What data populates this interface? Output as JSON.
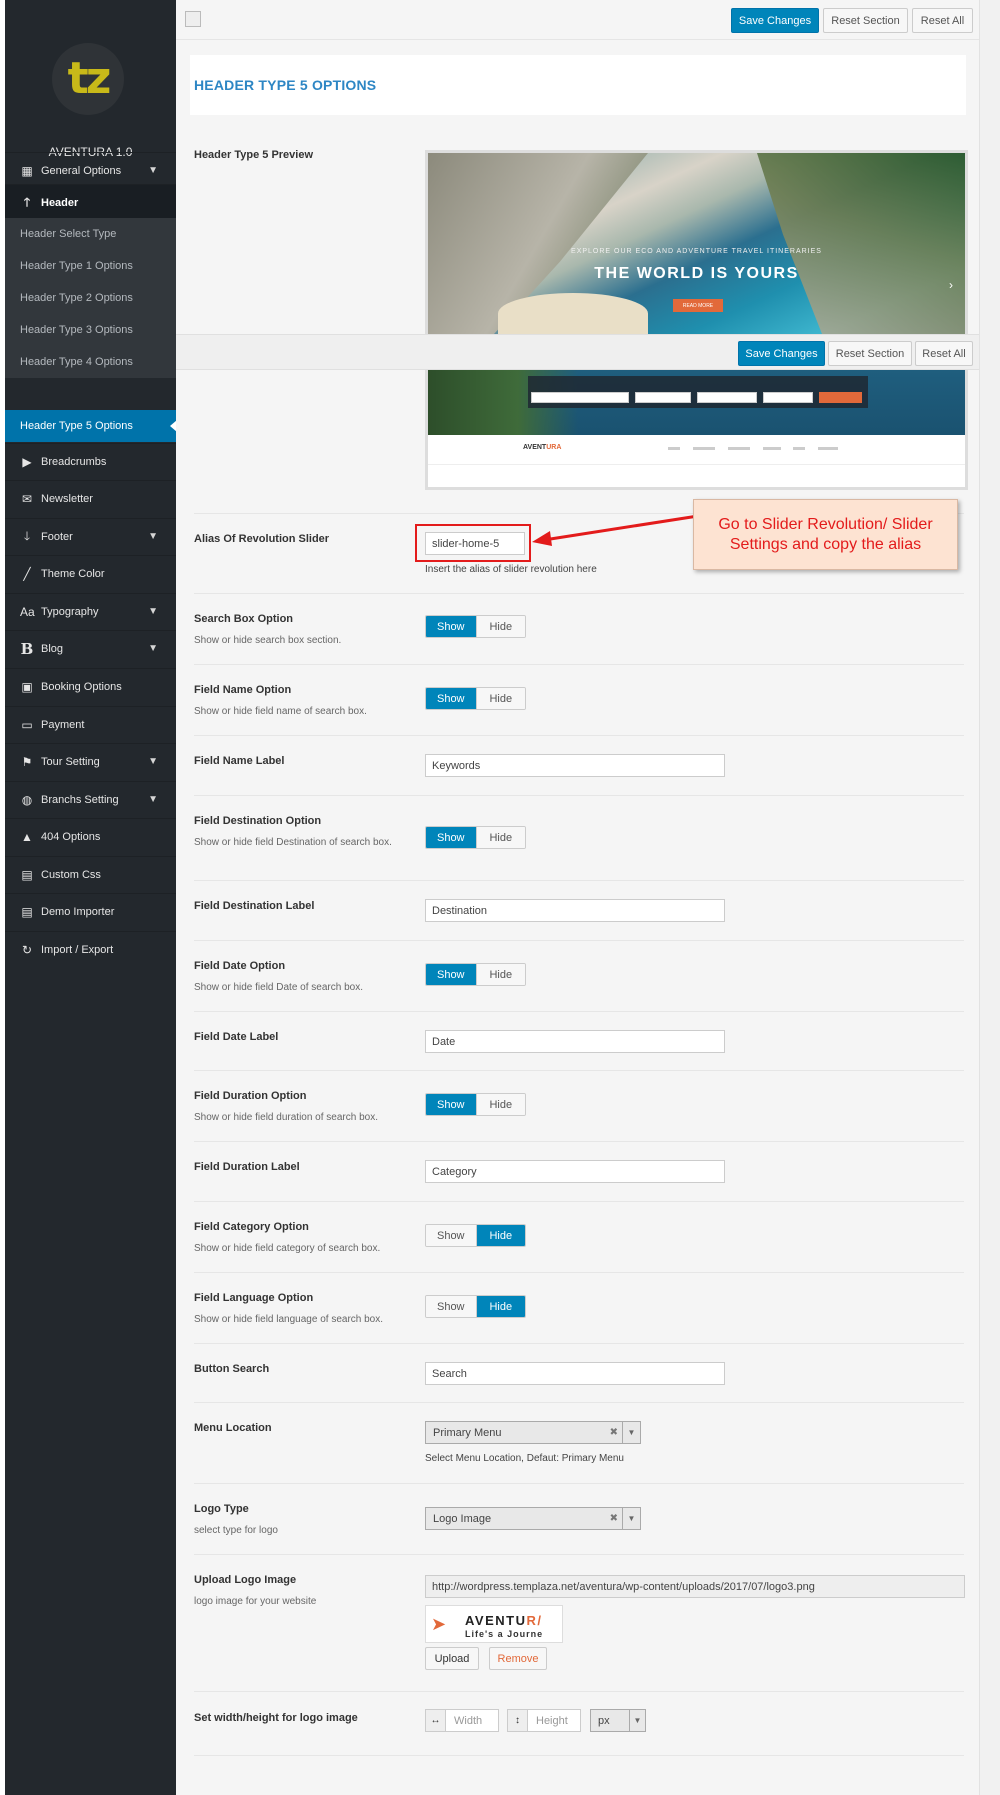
{
  "sidebar": {
    "logo_text": "tz",
    "version": "AVENTURA 1.0",
    "items": [
      {
        "label": "General Options"
      },
      {
        "label": "Header"
      },
      {
        "label": "Breadcrumbs"
      },
      {
        "label": "Newsletter"
      },
      {
        "label": "Footer"
      },
      {
        "label": "Theme Color"
      },
      {
        "label": "Typography"
      },
      {
        "label": "Blog"
      },
      {
        "label": "Booking Options"
      },
      {
        "label": "Payment"
      },
      {
        "label": "Tour Setting"
      },
      {
        "label": "Branchs Setting"
      },
      {
        "label": "404 Options"
      },
      {
        "label": "Custom Css"
      },
      {
        "label": "Demo Importer"
      },
      {
        "label": "Import / Export"
      }
    ],
    "sub_items": [
      {
        "label": "Header Select Type"
      },
      {
        "label": "Header Type 1 Options"
      },
      {
        "label": "Header Type 2 Options"
      },
      {
        "label": "Header Type 3 Options"
      },
      {
        "label": "Header Type 4 Options"
      },
      {
        "label": "Header Type 5 Options"
      }
    ]
  },
  "toolbar": {
    "save": "Save Changes",
    "reset_section": "Reset Section",
    "reset_all": "Reset All"
  },
  "section_title": "HEADER TYPE 5 OPTIONS",
  "preview": {
    "label": "Header Type 5 Preview",
    "hero_sub": "EXPLORE OUR ECO AND ADVENTURE TRAVEL ITINERARIES",
    "hero_title": "THE WORLD IS YOURS",
    "hero_btn": "READ MORE",
    "logo_a": "AVENT",
    "logo_b": "URA"
  },
  "callout": "Go to Slider Revolution/ Slider Settings and copy the alias",
  "rows": {
    "alias": {
      "label": "Alias Of Revolution Slider",
      "value": "slider-home-5",
      "hint": "Insert the alias of slider revolution here"
    },
    "search_box": {
      "label": "Search Box Option",
      "desc": "Show or hide search box section."
    },
    "field_name": {
      "label": "Field Name Option",
      "desc": "Show or hide field name of search box."
    },
    "field_name_label": {
      "label": "Field Name Label",
      "value": "Keywords"
    },
    "field_dest": {
      "label": "Field Destination Option",
      "desc": "Show or hide field Destination of search box."
    },
    "field_dest_label": {
      "label": "Field Destination Label",
      "value": "Destination"
    },
    "field_date": {
      "label": "Field Date Option",
      "desc": "Show or hide field Date of search box."
    },
    "field_date_label": {
      "label": "Field Date Label",
      "value": "Date"
    },
    "field_duration": {
      "label": "Field Duration Option",
      "desc": "Show or hide field duration of search box."
    },
    "field_duration_label": {
      "label": "Field Duration Label",
      "value": "Category"
    },
    "field_category": {
      "label": "Field Category Option",
      "desc": "Show or hide field category of search box."
    },
    "field_language": {
      "label": "Field Language Option",
      "desc": "Show or hide field language of search box."
    },
    "button_search": {
      "label": "Button Search",
      "value": "Search"
    },
    "menu_location": {
      "label": "Menu Location",
      "value": "Primary Menu",
      "hint": "Select Menu Location, Defaut: Primary Menu"
    },
    "logo_type": {
      "label": "Logo Type",
      "desc": "select type for logo",
      "value": "Logo Image"
    },
    "upload_logo": {
      "label": "Upload Logo Image",
      "desc": "logo image for your website",
      "url": "http://wordpress.templaza.net/aventura/wp-content/uploads/2017/07/logo3.png",
      "upload": "Upload",
      "remove": "Remove",
      "logo_a": "AVENTU",
      "logo_b": "R/",
      "tagline": "Life's a Journe"
    },
    "logo_size": {
      "label": "Set width/height for logo image",
      "width": "Width",
      "height": "Height",
      "unit": "px"
    }
  },
  "toggle": {
    "show": "Show",
    "hide": "Hide"
  },
  "icons": [
    "grid-icon",
    "arrow-up-icon",
    "play-icon",
    "envelope-icon",
    "arrow-down-icon",
    "brush-icon",
    "font-icon",
    "bold-b-icon",
    "id-card-icon",
    "credit-card-icon",
    "flag-icon",
    "globe-icon",
    "warning-icon",
    "css-icon",
    "importer-icon",
    "refresh-icon"
  ]
}
